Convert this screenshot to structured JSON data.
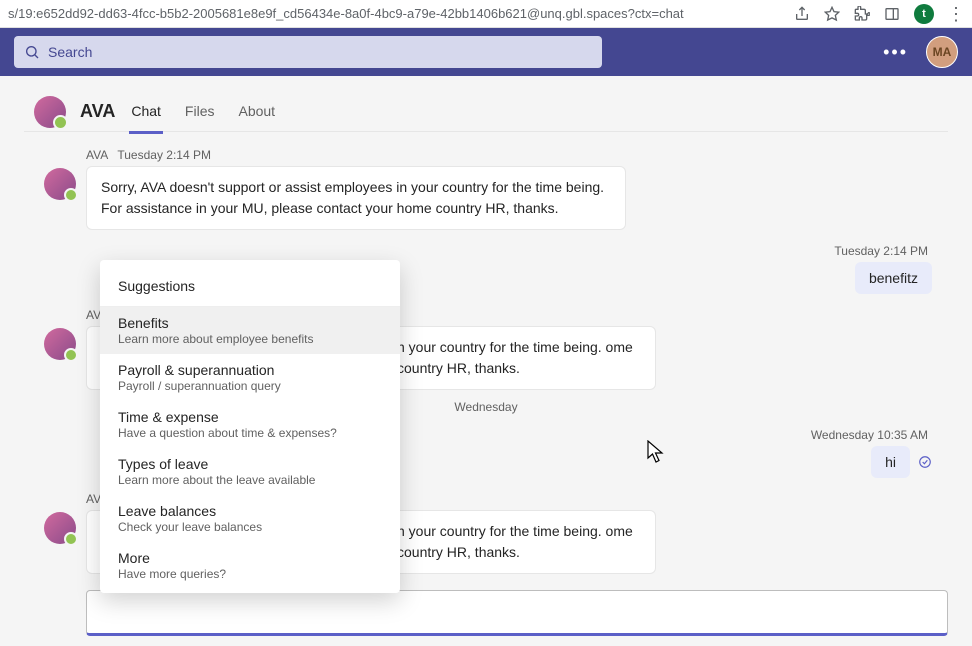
{
  "browser": {
    "url": "s/19:e652dd92-dd63-4fcc-b5b2-2005681e8e9f_cd56434e-8a0f-4bc9-a79e-42bb1406b621@unq.gbl.spaces?ctx=chat",
    "profile_initial": "t"
  },
  "top": {
    "search_placeholder": "Search",
    "user_initials": "MA"
  },
  "header": {
    "bot_name": "AVA",
    "tabs": {
      "chat": "Chat",
      "files": "Files",
      "about": "About"
    }
  },
  "messages": {
    "m1_meta_name": "AVA",
    "m1_meta_time": "Tuesday 2:14 PM",
    "m1_text": "Sorry, AVA doesn't support or assist employees in your country for the time being. For assistance in your MU, please contact your home country HR, thanks.",
    "u1_time": "Tuesday 2:14 PM",
    "u1_text": "benefitz",
    "m2_meta_name": "AV",
    "m2_text_tail": "n your country for the time being. ome country HR, thanks.",
    "day_sep": "Wednesday",
    "u2_time": "Wednesday 10:35 AM",
    "u2_text": "hi",
    "m3_meta_name": "AV",
    "m3_text_tail": "n your country for the time being. ome country HR, thanks."
  },
  "suggestions": {
    "title": "Suggestions",
    "items": [
      {
        "t": "Benefits",
        "d": "Learn more about employee benefits"
      },
      {
        "t": "Payroll & superannuation",
        "d": "Payroll / superannuation query"
      },
      {
        "t": "Time & expense",
        "d": "Have a question about time & expenses?"
      },
      {
        "t": "Types of leave",
        "d": "Learn more about the leave available"
      },
      {
        "t": "Leave balances",
        "d": "Check your leave balances"
      },
      {
        "t": "More",
        "d": "Have more queries?"
      }
    ]
  }
}
